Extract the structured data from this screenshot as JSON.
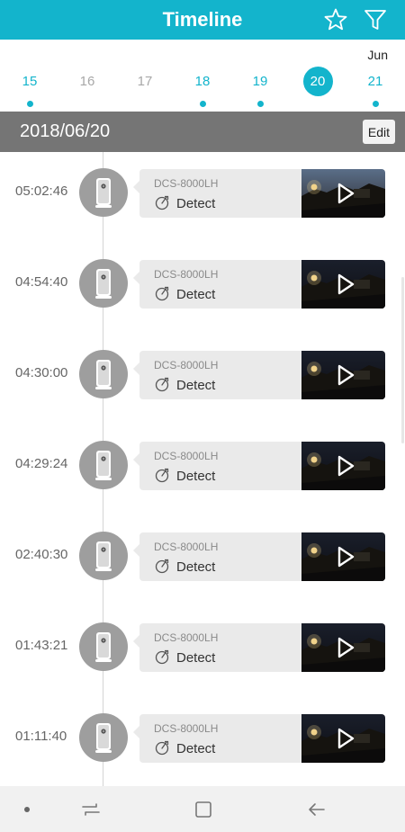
{
  "header": {
    "title": "Timeline",
    "star_icon": "star-icon",
    "filter_icon": "filter-icon"
  },
  "calendar": {
    "month": "Jun",
    "days": [
      {
        "label": "15",
        "has_events": true,
        "state": "active"
      },
      {
        "label": "16",
        "has_events": false,
        "state": "inactive"
      },
      {
        "label": "17",
        "has_events": false,
        "state": "inactive"
      },
      {
        "label": "18",
        "has_events": true,
        "state": "active"
      },
      {
        "label": "19",
        "has_events": true,
        "state": "active"
      },
      {
        "label": "20",
        "has_events": false,
        "state": "selected"
      },
      {
        "label": "21",
        "has_events": true,
        "state": "active"
      }
    ]
  },
  "date_bar": {
    "date": "2018/06/20",
    "edit_label": "Edit"
  },
  "events": [
    {
      "time": "05:02:46",
      "device": "DCS-8000LH",
      "type": "Detect"
    },
    {
      "time": "04:54:40",
      "device": "DCS-8000LH",
      "type": "Detect"
    },
    {
      "time": "04:30:00",
      "device": "DCS-8000LH",
      "type": "Detect"
    },
    {
      "time": "04:29:24",
      "device": "DCS-8000LH",
      "type": "Detect"
    },
    {
      "time": "02:40:30",
      "device": "DCS-8000LH",
      "type": "Detect"
    },
    {
      "time": "01:43:21",
      "device": "DCS-8000LH",
      "type": "Detect"
    },
    {
      "time": "01:11:40",
      "device": "DCS-8000LH",
      "type": "Detect"
    }
  ],
  "colors": {
    "accent": "#13b4cc",
    "date_bar": "#757575",
    "card": "#eaeaea",
    "avatar": "#9e9e9e"
  }
}
